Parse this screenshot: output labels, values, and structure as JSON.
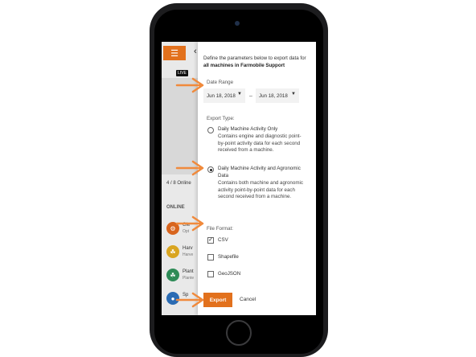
{
  "colors": {
    "accent": "#e2711d",
    "arrow": "#f08a3c"
  },
  "background_app": {
    "menu_icon": "hamburger-menu-icon",
    "live_badge": "LIVE",
    "online_count": "4 / 8 Online",
    "online_header": "ONLINE",
    "machines": [
      {
        "name": "Gle",
        "sub": "Opt",
        "color": "#d8651e",
        "icon": "tractor-icon"
      },
      {
        "name": "Harv",
        "sub": "Harve",
        "color": "#d9a520",
        "icon": "wheat-icon"
      },
      {
        "name": "Plant",
        "sub": "Plante",
        "color": "#2e8b57",
        "icon": "leaf-icon"
      },
      {
        "name": "Sp",
        "sub": "",
        "color": "#2a6bb3",
        "icon": "sprayer-icon"
      }
    ]
  },
  "dialog": {
    "intro_prefix": "Define the parameters below to export data for",
    "intro_bold": "all machines in Farmobile Support",
    "date_range_label": "Date Range",
    "date_start": "Jun 18, 2018",
    "date_end": "Jun 18, 2018",
    "date_separator": "–",
    "export_type_label": "Export Type:",
    "export_types": [
      {
        "title": "Daily Machine Activity Only",
        "description": "Contains engine and diagnostic point-by-point activity data for each second received from a machine.",
        "selected": false
      },
      {
        "title": "Daily Machine Activity and Agronomic Data",
        "description": "Contains both machine and agronomic activity point-by-point data for each second received from a machine.",
        "selected": true
      }
    ],
    "file_format_label": "File Format:",
    "file_formats": [
      {
        "label": "CSV",
        "checked": true
      },
      {
        "label": "Shapefile",
        "checked": false
      },
      {
        "label": "GeoJSON",
        "checked": false
      }
    ],
    "export_label": "Export",
    "cancel_label": "Cancel"
  }
}
